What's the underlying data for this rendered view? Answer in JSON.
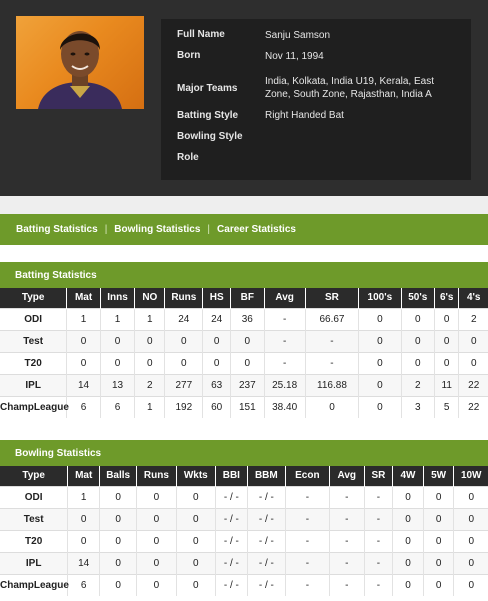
{
  "profile": {
    "full_name_label": "Full Name",
    "full_name": "Sanju Samson",
    "born_label": "Born",
    "born": "Nov 11, 1994",
    "teams_label": "Major Teams",
    "teams": "India, Kolkata, India U19, Kerala, East Zone, South Zone, Rajasthan, India A",
    "batting_style_label": "Batting Style",
    "batting_style": "Right Handed Bat",
    "bowling_style_label": "Bowling Style",
    "bowling_style": "",
    "role_label": "Role",
    "role": ""
  },
  "nav": {
    "batting": "Batting Statistics",
    "bowling": "Bowling Statistics",
    "career": "Career Statistics"
  },
  "batting": {
    "title": "Batting Statistics",
    "headers": [
      "Type",
      "Mat",
      "Inns",
      "NO",
      "Runs",
      "HS",
      "BF",
      "Avg",
      "SR",
      "100's",
      "50's",
      "6's",
      "4's"
    ],
    "rows": [
      [
        "ODI",
        "1",
        "1",
        "1",
        "24",
        "24",
        "36",
        "-",
        "66.67",
        "0",
        "0",
        "0",
        "2"
      ],
      [
        "Test",
        "0",
        "0",
        "0",
        "0",
        "0",
        "0",
        "-",
        "-",
        "0",
        "0",
        "0",
        "0"
      ],
      [
        "T20",
        "0",
        "0",
        "0",
        "0",
        "0",
        "0",
        "-",
        "-",
        "0",
        "0",
        "0",
        "0"
      ],
      [
        "IPL",
        "14",
        "13",
        "2",
        "277",
        "63",
        "237",
        "25.18",
        "116.88",
        "0",
        "2",
        "11",
        "22"
      ],
      [
        "ChampLeague",
        "6",
        "6",
        "1",
        "192",
        "60",
        "151",
        "38.40",
        "0",
        "0",
        "3",
        "5",
        "22"
      ]
    ]
  },
  "bowling": {
    "title": "Bowling Statistics",
    "headers": [
      "Type",
      "Mat",
      "Balls",
      "Runs",
      "Wkts",
      "BBI",
      "BBM",
      "Econ",
      "Avg",
      "SR",
      "4W",
      "5W",
      "10W"
    ],
    "rows": [
      [
        "ODI",
        "1",
        "0",
        "0",
        "0",
        "- / -",
        "- / -",
        "-",
        "-",
        "-",
        "0",
        "0",
        "0"
      ],
      [
        "Test",
        "0",
        "0",
        "0",
        "0",
        "- / -",
        "- / -",
        "-",
        "-",
        "-",
        "0",
        "0",
        "0"
      ],
      [
        "T20",
        "0",
        "0",
        "0",
        "0",
        "- / -",
        "- / -",
        "-",
        "-",
        "-",
        "0",
        "0",
        "0"
      ],
      [
        "IPL",
        "14",
        "0",
        "0",
        "0",
        "- / -",
        "- / -",
        "-",
        "-",
        "-",
        "0",
        "0",
        "0"
      ],
      [
        "ChampLeague",
        "6",
        "0",
        "0",
        "0",
        "- / -",
        "- / -",
        "-",
        "-",
        "-",
        "0",
        "0",
        "0"
      ]
    ]
  },
  "colors": {
    "accent_green": "#6e9a2a",
    "header_dark": "#2e2e2e",
    "table_header": "#2b2b2b"
  }
}
